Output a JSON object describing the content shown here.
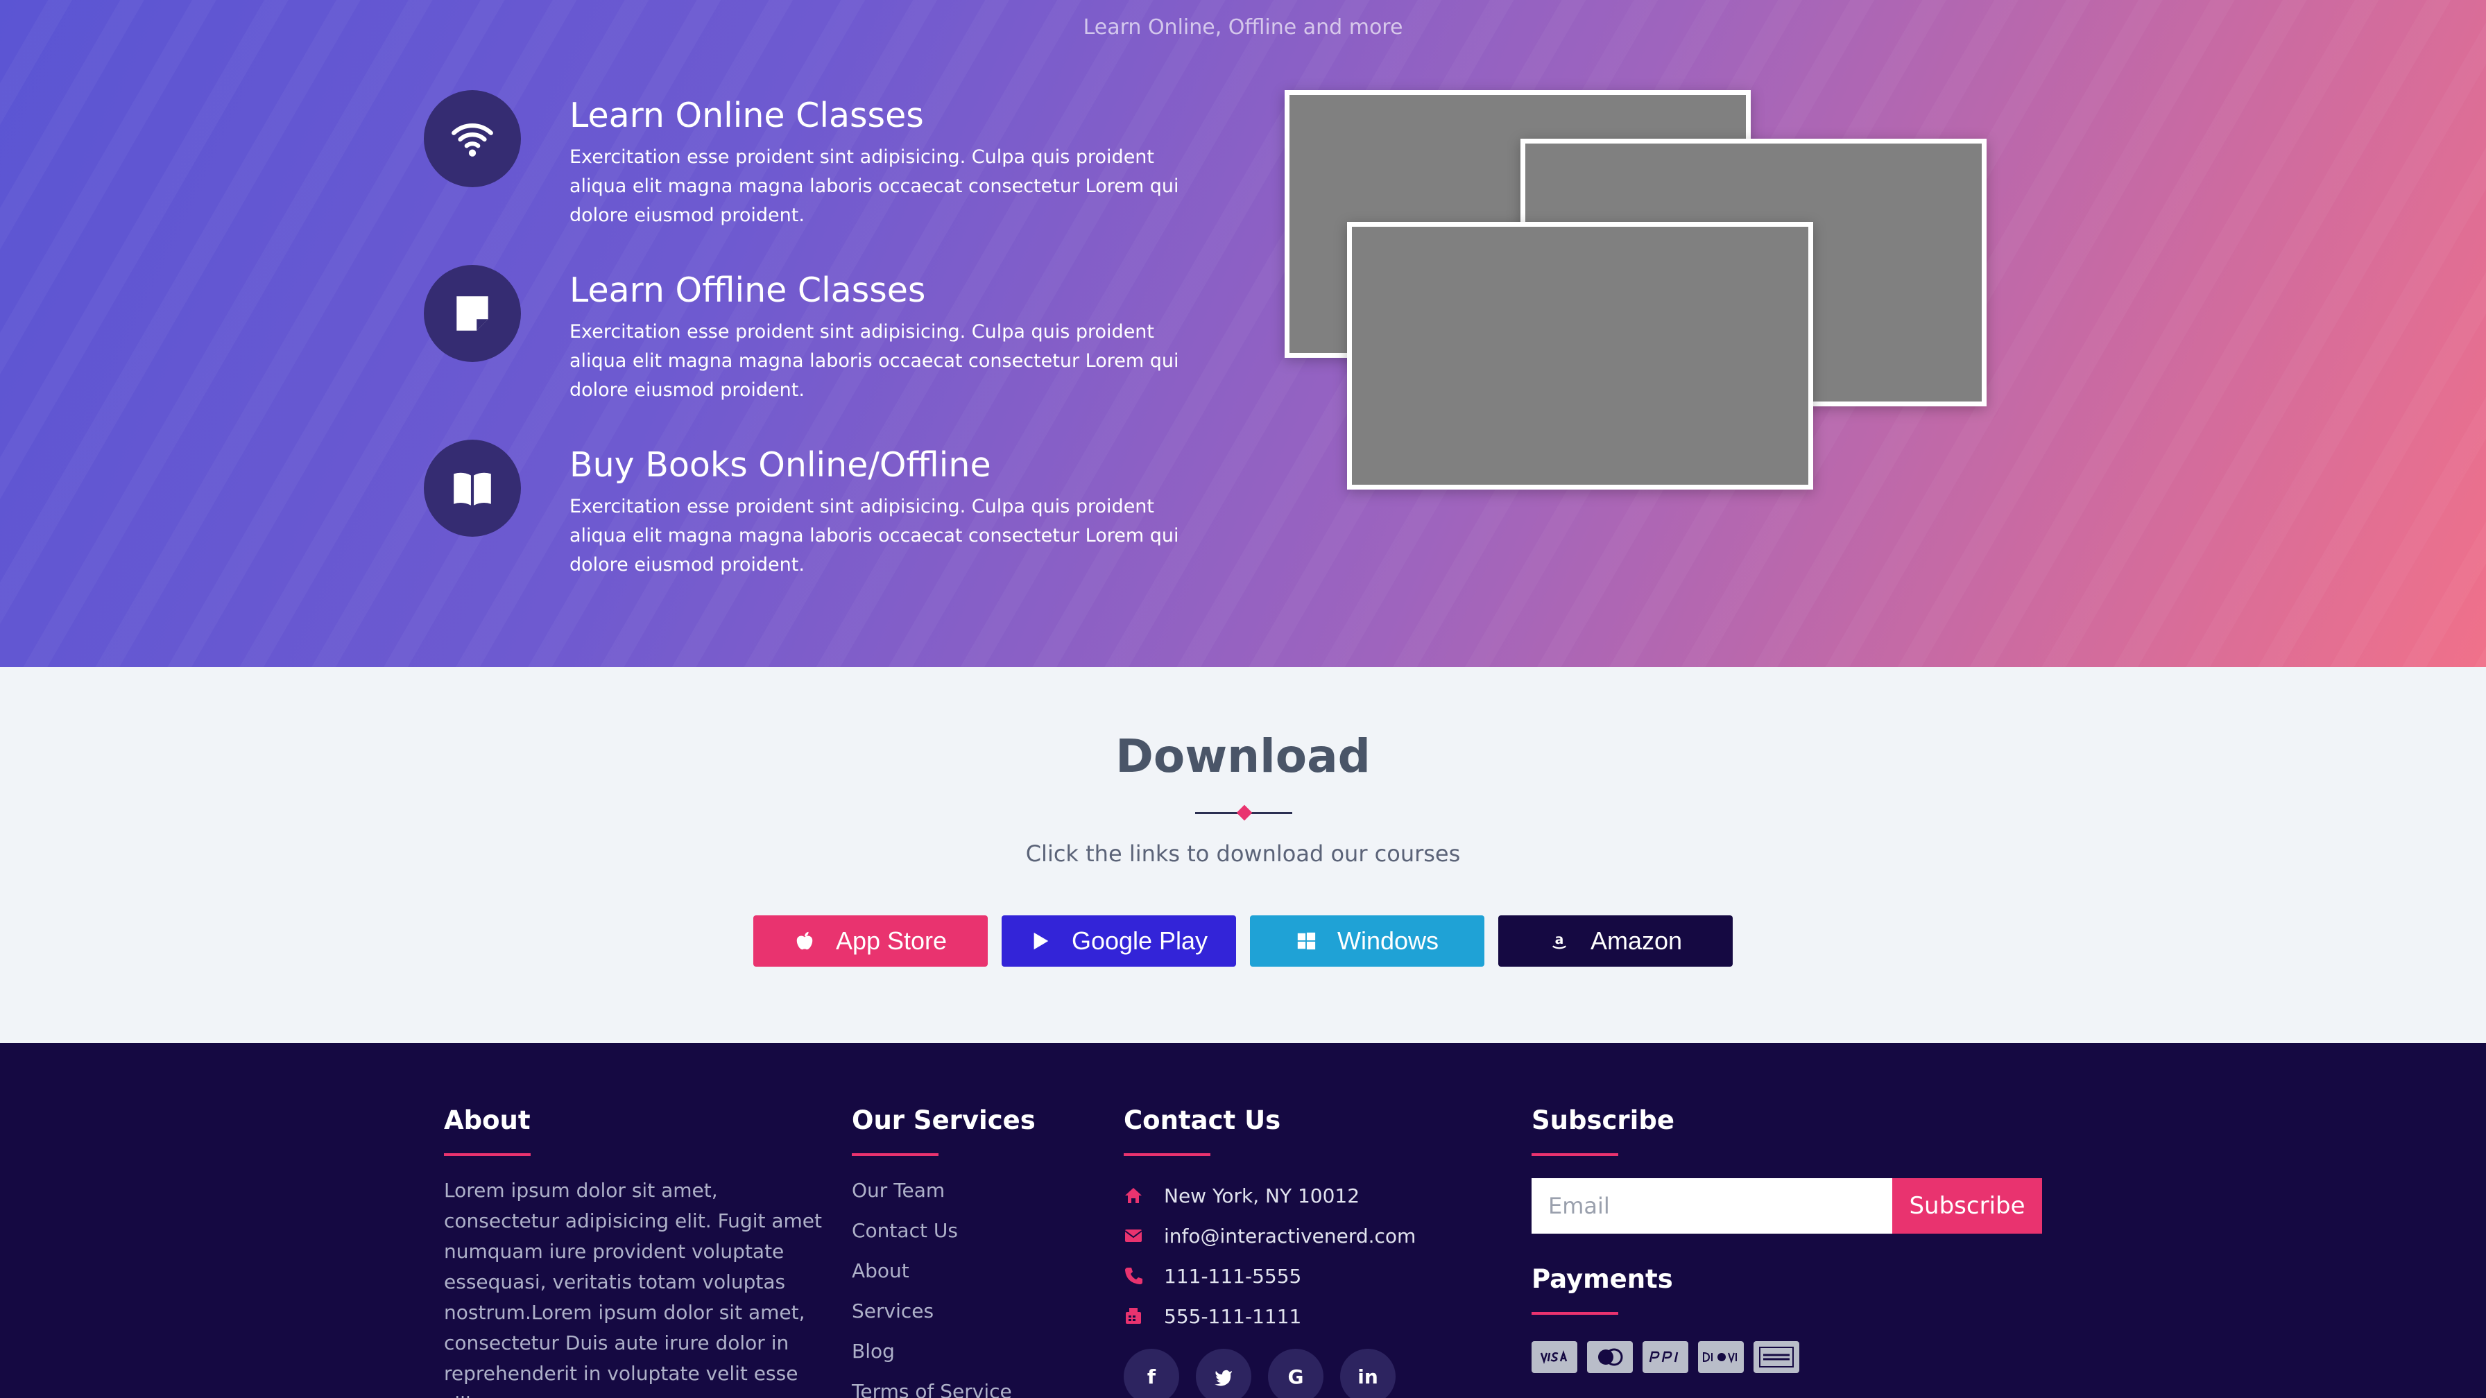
{
  "hero": {
    "tagline": "Learn Online, Offline and more",
    "features": [
      {
        "title": "Learn Online Classes",
        "desc": "Exercitation esse proident sint adipisicing. Culpa quis proident aliqua elit magna magna laboris occaecat consectetur Lorem qui dolore eiusmod proident.",
        "icon": "wifi-icon"
      },
      {
        "title": "Learn Offline Classes",
        "desc": "Exercitation esse proident sint adipisicing. Culpa quis proident aliqua elit magna magna laboris occaecat consectetur Lorem qui dolore eiusmod proident.",
        "icon": "note-icon"
      },
      {
        "title": "Buy Books Online/Offline",
        "desc": "Exercitation esse proident sint adipisicing. Culpa quis proident aliqua elit magna magna laboris occaecat consectetur Lorem qui dolore eiusmod proident.",
        "icon": "book-icon"
      }
    ]
  },
  "download": {
    "title": "Download",
    "subtitle": "Click the links to download our courses",
    "buttons": [
      {
        "label": "App Store",
        "icon": "apple-icon",
        "color": "#e9336f"
      },
      {
        "label": "Google Play",
        "icon": "google-play-icon",
        "color": "#3324d8"
      },
      {
        "label": "Windows",
        "icon": "windows-icon",
        "color": "#1fa2d6"
      },
      {
        "label": "Amazon",
        "icon": "amazon-icon",
        "color": "#150942"
      }
    ]
  },
  "footer": {
    "about": {
      "heading": "About",
      "text": "Lorem ipsum dolor sit amet, consectetur adipisicing elit. Fugit amet numquam iure provident voluptate essequasi, veritatis totam voluptas nostrum.Lorem ipsum dolor sit amet, consectetur Duis aute irure dolor in reprehenderit in voluptate velit esse cillum ."
    },
    "services": {
      "heading": "Our Services",
      "links": [
        "Our Team",
        "Contact Us",
        "About",
        "Services",
        "Blog",
        "Terms of Service"
      ]
    },
    "contact": {
      "heading": "Contact Us",
      "address": "New York, NY 10012",
      "email": "info@interactivenerd.com",
      "phone": "111-111-5555",
      "fax": "555-111-1111",
      "social": [
        "facebook-icon",
        "twitter-icon",
        "google-icon",
        "linkedin-icon"
      ]
    },
    "subscribe": {
      "heading": "Subscribe",
      "placeholder": "Email",
      "button": "Subscribe",
      "payments_heading": "Payments",
      "payments": [
        "visa-icon",
        "mastercard-icon",
        "paypal-icon",
        "discover-icon",
        "amex-icon"
      ]
    }
  }
}
